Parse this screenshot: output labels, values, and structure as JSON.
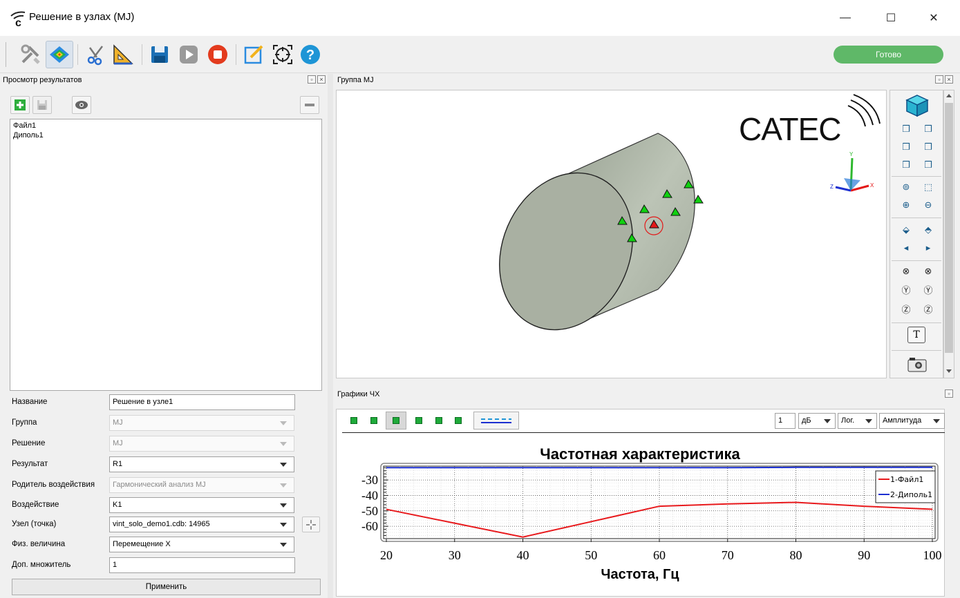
{
  "window": {
    "title": "Решение в узлах (MJ)",
    "minimize_glyph": "—",
    "maximize_glyph": "☐",
    "close_glyph": "✕"
  },
  "toolbar": {
    "status": "Готово",
    "icons": [
      "tools-icon",
      "result-map-icon",
      "cut-icon",
      "ruler-triangle-icon",
      "save-icon",
      "play-icon",
      "stop-icon",
      "edit-icon",
      "target-icon",
      "help-icon"
    ]
  },
  "results_panel": {
    "title": "Просмотр результатов",
    "items": [
      "Файл1",
      "Диполь1"
    ]
  },
  "properties": {
    "name_label": "Название",
    "name_value": "Решение в узле1",
    "group_label": "Группа",
    "group_value": "MJ",
    "solution_label": "Решение",
    "solution_value": "MJ",
    "result_label": "Результат",
    "result_value": "R1",
    "parent_label": "Родитель воздействия",
    "parent_value": "Гармонический анализ MJ",
    "action_label": "Воздействие",
    "action_value": "K1",
    "node_label": "Узел (точка)",
    "node_value": "vint_solo_demo1.cdb: 14965",
    "phys_label": "Физ. величина",
    "phys_value": "Перемещение X",
    "mult_label": "Доп. множитель",
    "mult_value": "1",
    "apply_label": "Применить"
  },
  "viewport_panel": {
    "title": "Группа MJ",
    "logo_text": "CATEC",
    "axes": {
      "x": "X",
      "y": "Y",
      "z": "Z"
    },
    "text_tool": "T"
  },
  "chart_panel": {
    "title": "Графики ЧХ",
    "count_value": "1",
    "unit_value": "дБ",
    "scale_value": "Лог.",
    "mode_value": "Амплитуда"
  },
  "colors": {
    "series1": "#e8191c",
    "series2": "#1b2fd1",
    "status": "#5fb868",
    "marker_ok": "#10d010",
    "marker_sel": "#e31818"
  },
  "chart_data": {
    "type": "line",
    "title": "Частотная характеристика",
    "xlabel": "Частота, Гц",
    "ylabel": "",
    "xlim": [
      20,
      100
    ],
    "ylim": [
      -68,
      -21
    ],
    "xticks": [
      20,
      30,
      40,
      50,
      60,
      70,
      80,
      90,
      100
    ],
    "yticks": [
      -30,
      -40,
      -50,
      -60
    ],
    "grid": true,
    "legend": "top-right",
    "series": [
      {
        "name": "1-Файл1",
        "x": [
          20,
          30,
          40,
          50,
          60,
          70,
          80,
          90,
          100
        ],
        "y": [
          -49,
          -58,
          -67,
          -57,
          -47,
          -45.5,
          -44.5,
          -47,
          -49
        ]
      },
      {
        "name": "2-Диполь1",
        "x": [
          20,
          30,
          40,
          50,
          60,
          70,
          80,
          90,
          100
        ],
        "y": [
          -22,
          -22,
          -22,
          -22,
          -22,
          -22,
          -21.8,
          -21.8,
          -21.8
        ]
      }
    ]
  }
}
